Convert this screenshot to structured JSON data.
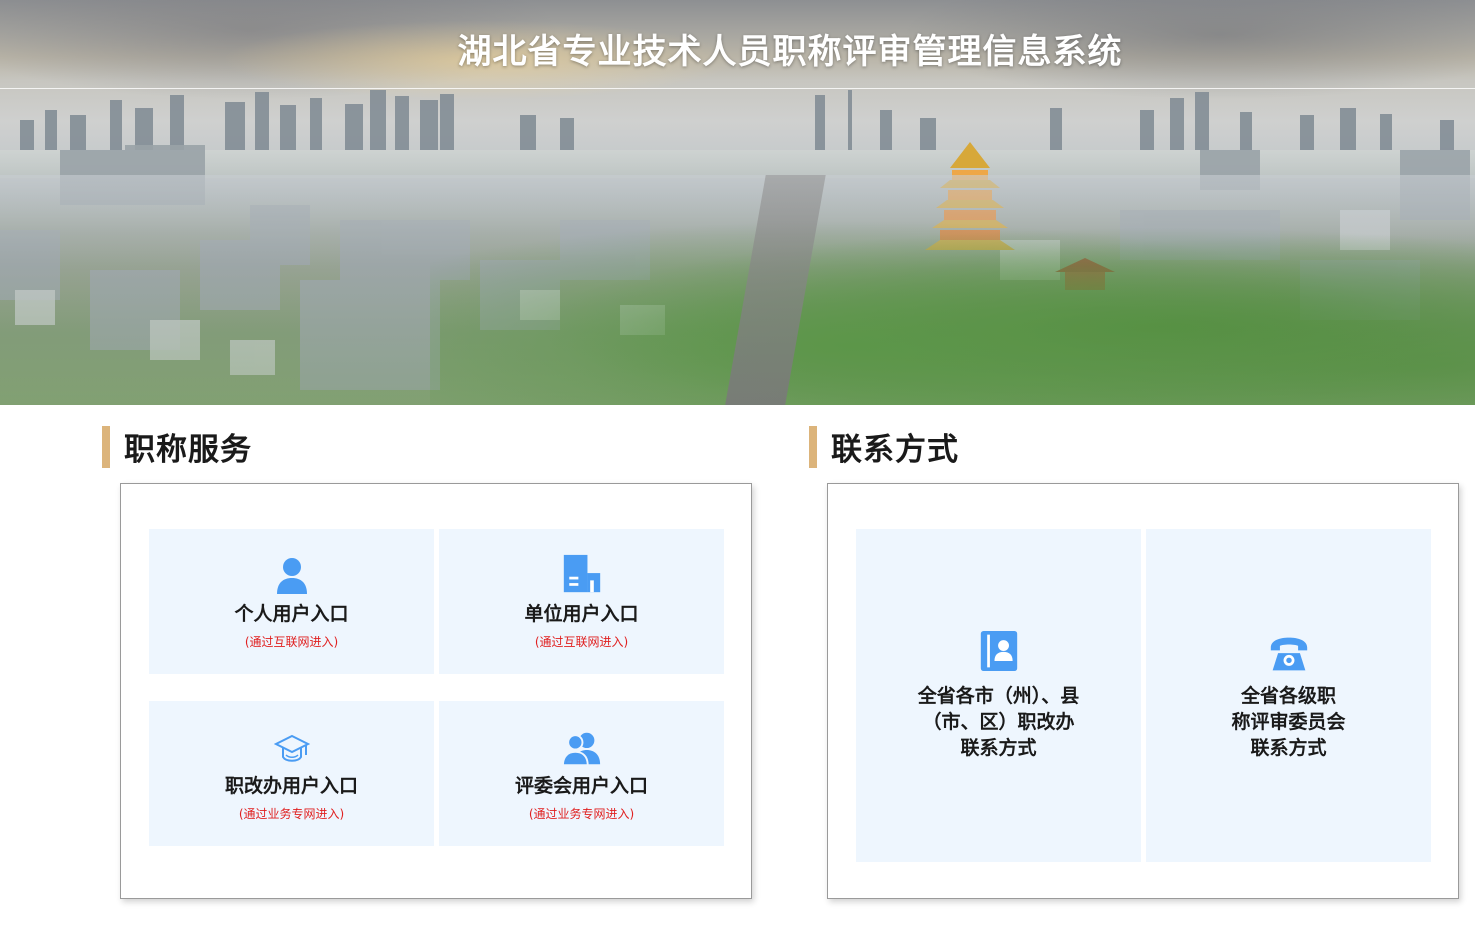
{
  "header": {
    "title": "湖北省专业技术人员职称评审管理信息系统"
  },
  "services": {
    "heading": "职称服务",
    "tiles": [
      {
        "title": "个人用户入口",
        "subtitle": "(通过互联网进入)",
        "icon": "person-icon"
      },
      {
        "title": "单位用户入口",
        "subtitle": "(通过互联网进入)",
        "icon": "building-icon"
      },
      {
        "title": "职改办用户入口",
        "subtitle": "(通过业务专网进入)",
        "icon": "graduation-cap-icon"
      },
      {
        "title": "评委会用户入口",
        "subtitle": "(通过业务专网进入)",
        "icon": "group-icon"
      }
    ]
  },
  "contact": {
    "heading": "联系方式",
    "tiles": [
      {
        "line1": "全省各市（州）、县",
        "line2": "（市、区）职改办",
        "line3": "联系方式",
        "icon": "contact-book-icon"
      },
      {
        "line1": "全省各级职",
        "line2": "称评审委员会",
        "line3": "联系方式",
        "icon": "telephone-icon"
      }
    ]
  },
  "colors": {
    "accent_bar": "#dcb47b",
    "tile_bg": "#eef6fe",
    "icon_blue": "#4a9cf3",
    "subtitle_red": "#e02020"
  }
}
